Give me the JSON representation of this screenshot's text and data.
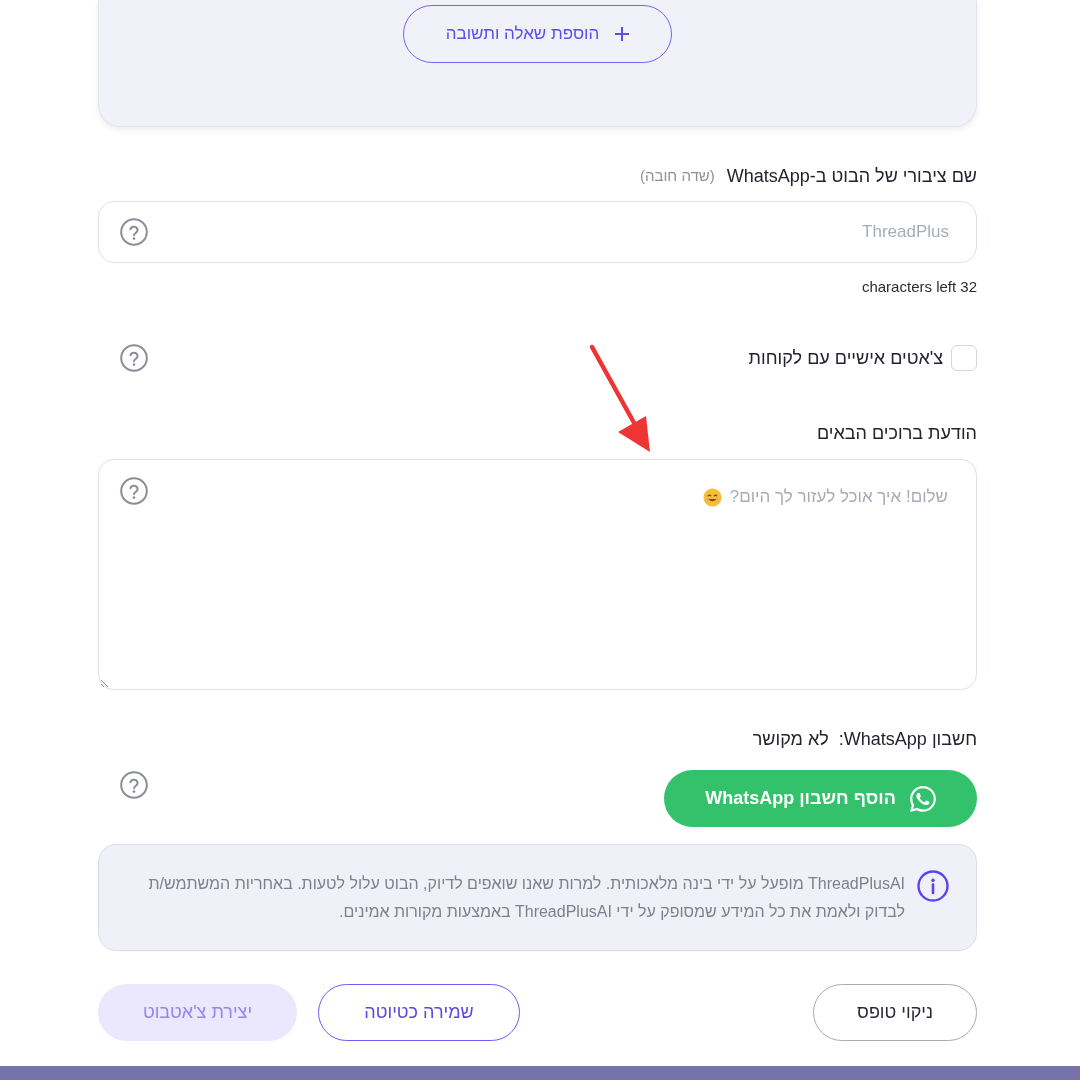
{
  "faq_section": {
    "add_button": "הוספת שאלה ותשובה"
  },
  "bot_name": {
    "label": "שם ציבורי של הבוט ב-WhatsApp",
    "required_note": "(שדה חובה)",
    "placeholder": "ThreadPlus",
    "counter": "characters left 32"
  },
  "personal_chats": {
    "label": "צ'אטים אישיים עם לקוחות",
    "checked": false
  },
  "welcome_message": {
    "label": "הודעת ברוכים הבאים",
    "placeholder": "שלום! איך אוכל לעזור לך היום?"
  },
  "whatsapp_account": {
    "label": "חשבון WhatsApp:",
    "status": "לא מקושר",
    "connect_button": "הוסף חשבון WhatsApp"
  },
  "notice": {
    "text": "ThreadPlusAI מופעל על ידי בינה מלאכותית. למרות שאנו שואפים לדיוק, הבוט עלול לטעות. באחריות המשתמש/ת לבדוק ולאמת את כל המידע שמסופק על ידי ThreadPlusAI באמצעות מקורות אמינים."
  },
  "actions": [
    {
      "label": "ניקוי טופס",
      "kind": "secondary",
      "disabled": false
    },
    {
      "label": "שמירה כטיוטה",
      "kind": "outline",
      "disabled": false
    },
    {
      "label": "יצירת צ'אטבוט",
      "kind": "primary",
      "disabled": true
    }
  ]
}
